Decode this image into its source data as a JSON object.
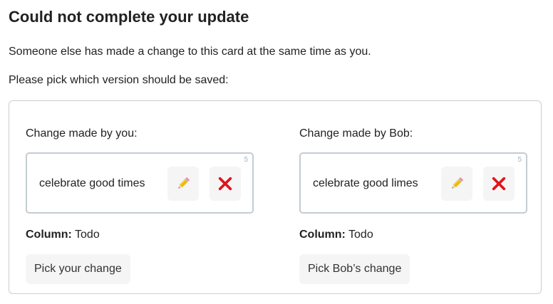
{
  "page": {
    "title": "Could not complete your update",
    "message": "Someone else has made a change to this card at the same time as you.",
    "prompt": "Please pick which version should be saved:"
  },
  "options": [
    {
      "heading": "Change made by you:",
      "card_text": "celebrate good times",
      "votes": "5",
      "column_label": "Column:",
      "column_value": "Todo",
      "pick_label": "Pick your change"
    },
    {
      "heading": "Change made by Bob:",
      "card_text": "celebrate good limes",
      "votes": "5",
      "column_label": "Column:",
      "column_value": "Todo",
      "pick_label": "Pick Bob’s change"
    }
  ],
  "icons": {
    "edit": "pencil-icon",
    "delete": "cross-icon"
  },
  "colors": {
    "delete_red": "#e0141e",
    "pencil_yellow": "#f2b705",
    "card_border": "#c3ccd3",
    "button_bg": "#f5f5f5"
  }
}
